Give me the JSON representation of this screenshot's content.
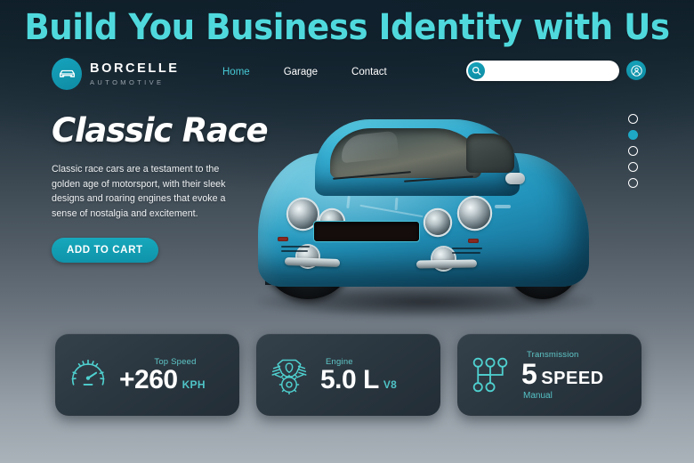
{
  "headline": "Build You Business Identity with Us",
  "brand": {
    "name": "BORCELLE",
    "tagline": "AUTOMOTIVE",
    "icon": "car-icon"
  },
  "nav": {
    "links": [
      {
        "label": "Home",
        "active": true
      },
      {
        "label": "Garage",
        "active": false
      },
      {
        "label": "Contact",
        "active": false
      }
    ]
  },
  "search": {
    "value": "",
    "placeholder": "",
    "icon": "search-icon"
  },
  "account": {
    "icon": "user-account-icon"
  },
  "hero": {
    "title": "Classic Race",
    "description": "Classic race cars are a testament to the golden age of motorsport, with their sleek designs and roaring engines that evoke a sense of nostalgia and excitement.",
    "cta_label": "ADD TO CART",
    "image_alt": "blue classic race car"
  },
  "carousel": {
    "total_dots": 5,
    "active_index": 1
  },
  "stats": [
    {
      "icon": "speedometer-icon",
      "label": "Top Speed",
      "value": "+260",
      "unit": "KPH",
      "sub": ""
    },
    {
      "icon": "engine-icon",
      "label": "Engine",
      "value": "5.0 L",
      "unit": "V8",
      "sub": ""
    },
    {
      "icon": "gear-shift-icon",
      "label": "Transmission",
      "value": "5",
      "unit": "SPEED",
      "sub": "Manual"
    }
  ],
  "colors": {
    "accent_cyan": "#4fd9dd",
    "teal": "#17a4bb",
    "stat_label": "#5fc7c8",
    "text_white": "#ffffff",
    "bg_top": "#0f1e28",
    "bg_bottom": "#aab2ba"
  }
}
